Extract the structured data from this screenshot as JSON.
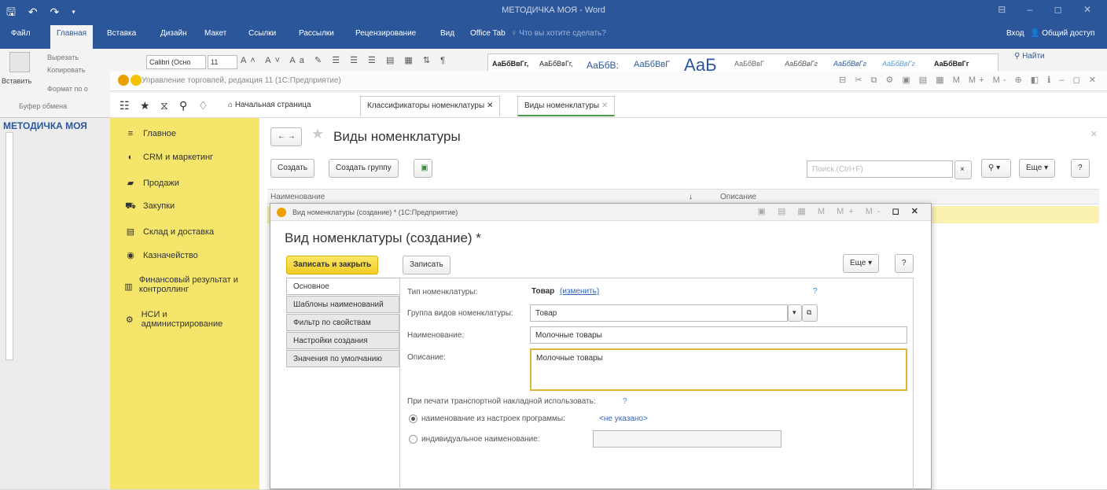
{
  "word": {
    "qat": "🖫 ↶ ↷ ▾",
    "title": "МЕТОДИЧКА МОЯ - Word",
    "window_controls": "⊟ – ◻ ✕",
    "menu": [
      "Файл",
      "Главная",
      "Вставка",
      "Дизайн",
      "Макет",
      "Ссылки",
      "Рассылки",
      "Рецензирование",
      "Вид",
      "Office Tab",
      "♀ Что вы хотите сделать?"
    ],
    "signin": "Вход",
    "share": "Общий доступ",
    "paste": "Вставить",
    "cut": "Вырезать",
    "copy": "Копировать",
    "format_painter": "Формат по о",
    "clipboard": "Буфер обмена",
    "font_name": "Calibri (Осно",
    "font_size": "11",
    "styles": [
      "АаБбВвГг,",
      "АаБбВвГг,",
      "АаБбВ:",
      "АаБбВвГ",
      "АаБ",
      "АаБбВвГ",
      "АаБбВвГг",
      "АаБбВвГг",
      "АаБбВвГг",
      "АаБбВвГг"
    ],
    "find": "Найти",
    "doc_name": "МЕТОДИЧКА МОЯ"
  },
  "c1": {
    "title": "Управление торговлей, редакция 11 (1С:Предприятие)",
    "title_tools": "⊟ ✂ ⧉ ⚙ ▣ ▤ ▦ M M+ M- ⊕ ◧ ℹ – ◻ ✕",
    "tabs": {
      "home": "Начальная страница",
      "classifiers": "Классификаторы номенклатуры",
      "kinds": "Виды номенклатуры"
    },
    "sidebar": [
      {
        "icon": "≡",
        "label": "Главное"
      },
      {
        "icon": "◐",
        "label": "CRM и маркетинг"
      },
      {
        "icon": "▰",
        "label": "Продажи"
      },
      {
        "icon": "⛟",
        "label": "Закупки"
      },
      {
        "icon": "▤",
        "label": "Склад и доставка"
      },
      {
        "icon": "◉",
        "label": "Казначейство"
      },
      {
        "icon": "▥",
        "label": "Финансовый результат и контроллинг"
      },
      {
        "icon": "⚙",
        "label": "НСИ и администрирование"
      }
    ],
    "list": {
      "title": "Виды номенклатуры",
      "create": "Создать",
      "create_group": "Создать группу",
      "search_placeholder": "Поиск (Ctrl+F)",
      "more": "Еще",
      "help": "?",
      "col_name": "Наименование",
      "col_desc": "Описание",
      "sort_icon": "↓"
    }
  },
  "dialog": {
    "window_title": "Вид номенклатуры (создание) * (1С:Предприятие)",
    "heading": "Вид номенклатуры (создание) *",
    "save_close": "Записать и закрыть",
    "save": "Записать",
    "more": "Еще",
    "help": "?",
    "tabs": [
      "Основное",
      "Шаблоны наименований",
      "Фильтр по свойствам",
      "Настройки создания",
      "Значения по умолчанию"
    ],
    "type_label": "Тип номенклатуры:",
    "type_value": "Товар",
    "type_change": "(изменить)",
    "group_label": "Группа видов номенклатуры:",
    "group_value": "Товар",
    "name_label": "Наименование:",
    "name_value": "Молочные товары",
    "desc_label": "Описание:",
    "desc_value": "Молочные товары",
    "print_label": "При печати транспортной накладной использовать:",
    "print_help": "?",
    "opt1": "наименование из настроек программы:",
    "opt1_link": "<не указано>",
    "opt2": "индивидуальное наименование:"
  }
}
